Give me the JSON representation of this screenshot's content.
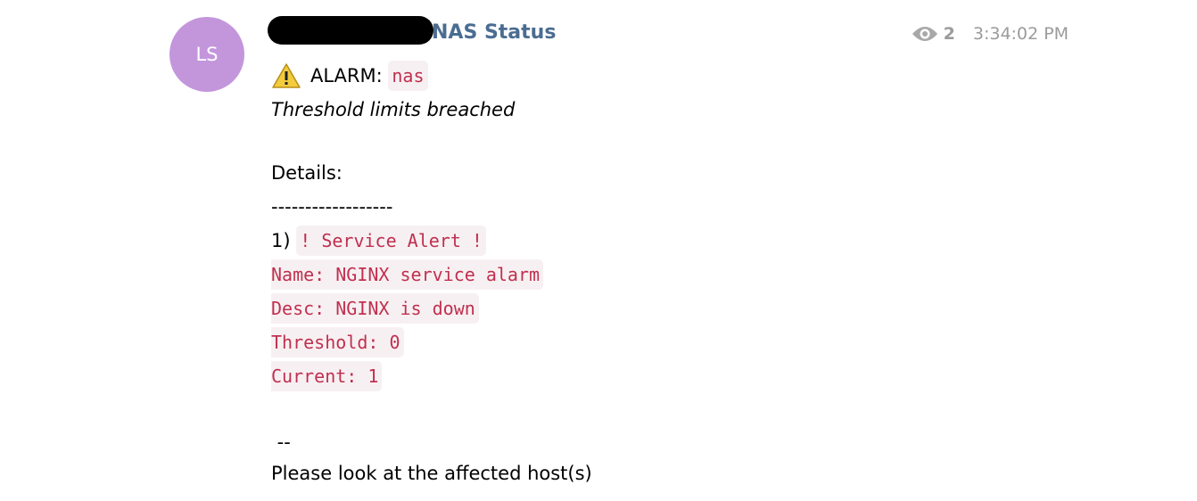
{
  "message": {
    "avatar_initials": "LS",
    "avatar_color": "#c396dc",
    "sender_suffix": "NAS Status",
    "seen_count": "2",
    "timestamp": "3:34:02 PM",
    "alarm_label": "ALARM:",
    "alarm_host": "nas",
    "subtitle": "Threshold limits breached",
    "details_label": "Details:",
    "separator": "------------------",
    "item_number": "1)",
    "item_title": "! Service Alert !",
    "item_lines": [
      "Name: NGINX service alarm",
      "Desc: NGINX is down",
      "Threshold: 0",
      "Current: 1"
    ],
    "signature_dash": " --",
    "footer": "Please look at the affected host(s)"
  }
}
